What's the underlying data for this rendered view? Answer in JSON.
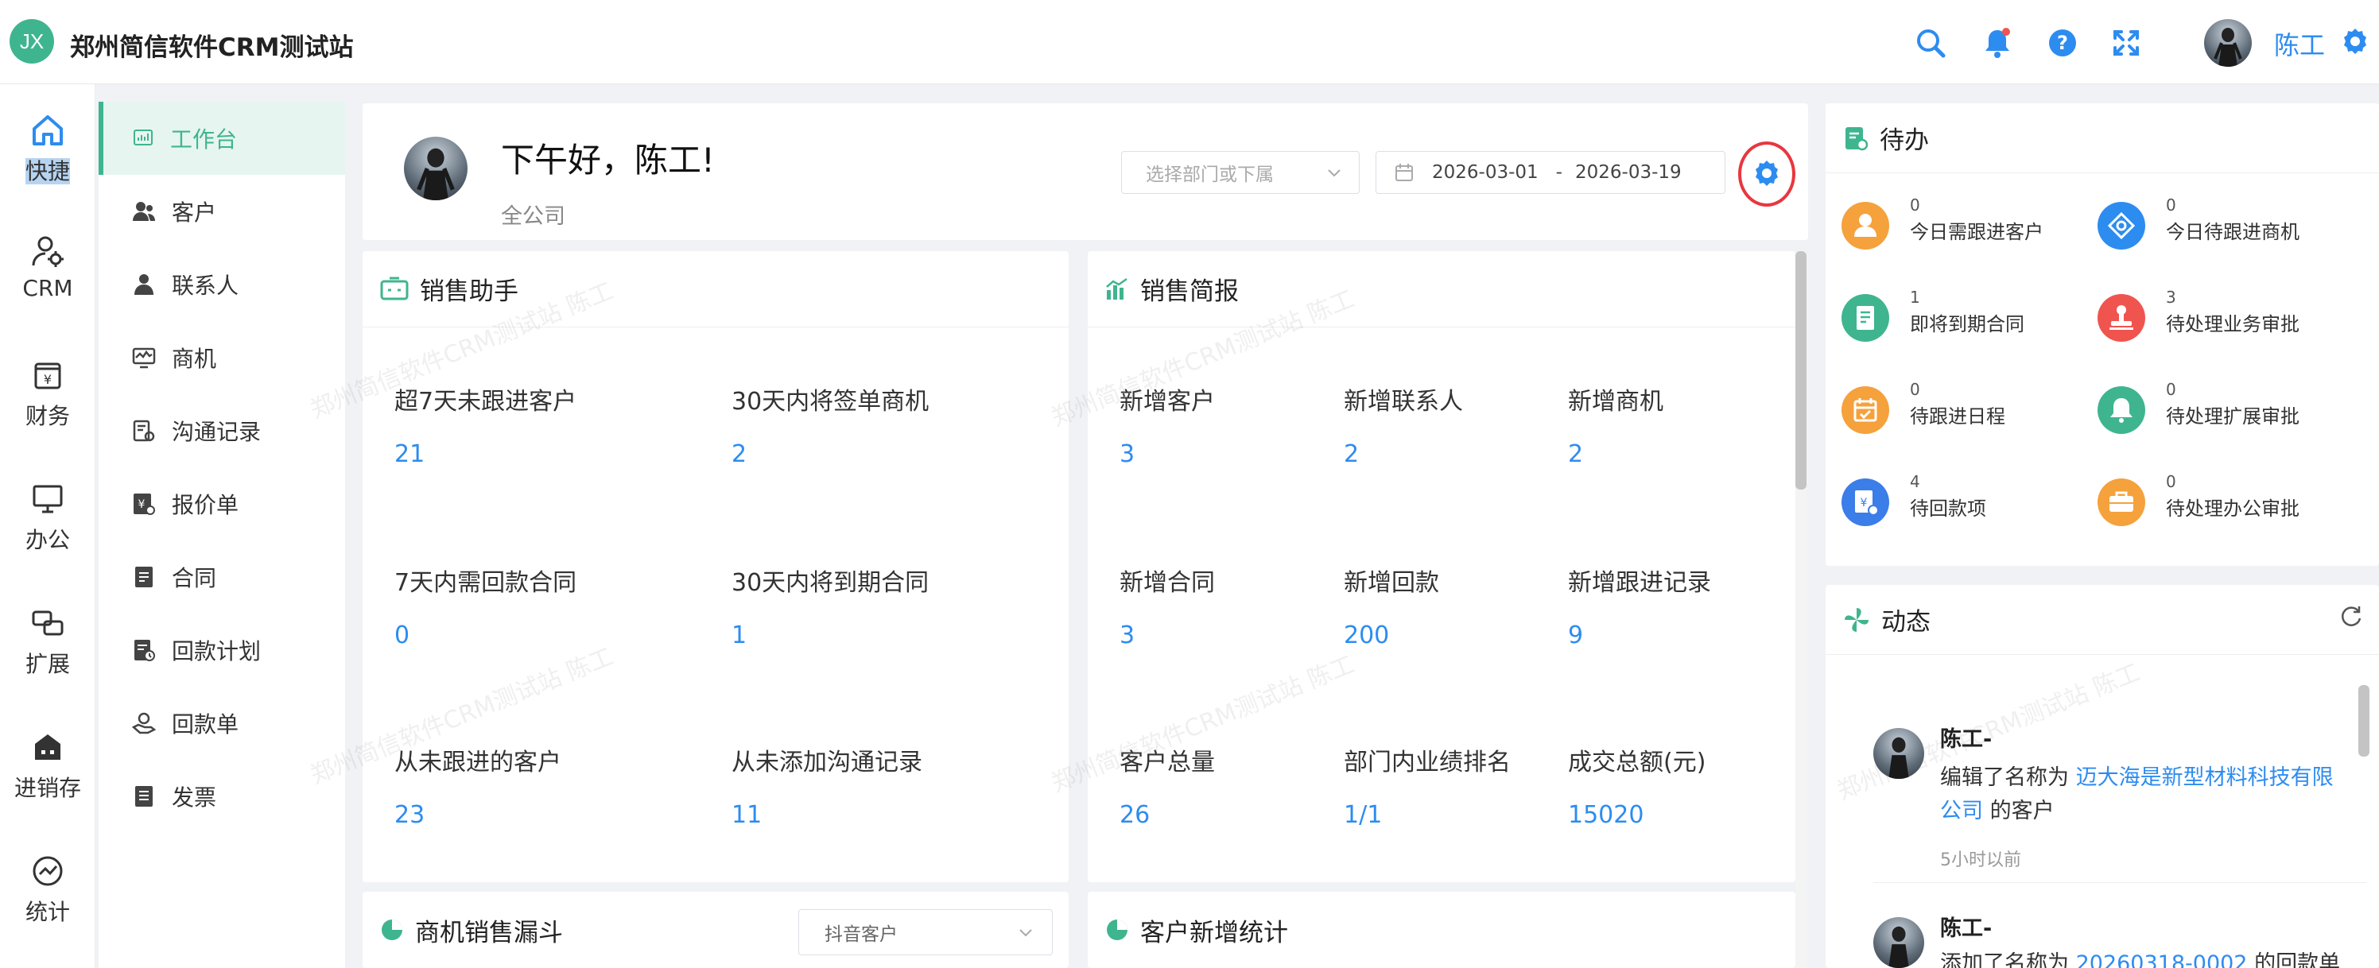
{
  "app": {
    "logo": "JX",
    "title": "郑州简信软件CRM测试站"
  },
  "user": {
    "name": "陈工"
  },
  "rail": [
    {
      "label": "快捷",
      "icon": "home-icon"
    },
    {
      "label": "CRM",
      "icon": "crm-icon"
    },
    {
      "label": "财务",
      "icon": "finance-icon"
    },
    {
      "label": "办公",
      "icon": "office-icon"
    },
    {
      "label": "扩展",
      "icon": "extend-icon"
    },
    {
      "label": "进销存",
      "icon": "inventory-icon"
    },
    {
      "label": "统计",
      "icon": "stats-icon"
    }
  ],
  "menu": [
    {
      "label": "工作台"
    },
    {
      "label": "客户"
    },
    {
      "label": "联系人"
    },
    {
      "label": "商机"
    },
    {
      "label": "沟通记录"
    },
    {
      "label": "报价单"
    },
    {
      "label": "合同"
    },
    {
      "label": "回款计划"
    },
    {
      "label": "回款单"
    },
    {
      "label": "发票"
    }
  ],
  "greeting": {
    "title": "下午好，陈工!",
    "scope": "全公司",
    "dept_placeholder": "选择部门或下属",
    "date_start": "2026-03-01",
    "date_sep": "-",
    "date_end": "2026-03-19"
  },
  "assistant": {
    "title": "销售助手",
    "items": [
      {
        "label": "超7天未跟进客户",
        "value": "21"
      },
      {
        "label": "30天内将签单商机",
        "value": "2"
      },
      {
        "label": "7天内需回款合同",
        "value": "0"
      },
      {
        "label": "30天内将到期合同",
        "value": "1"
      },
      {
        "label": "从未跟进的客户",
        "value": "23"
      },
      {
        "label": "从未添加沟通记录",
        "value": "11"
      }
    ]
  },
  "brief": {
    "title": "销售简报",
    "items": [
      {
        "label": "新增客户",
        "value": "3"
      },
      {
        "label": "新增联系人",
        "value": "2"
      },
      {
        "label": "新增商机",
        "value": "2"
      },
      {
        "label": "新增合同",
        "value": "3"
      },
      {
        "label": "新增回款",
        "value": "200"
      },
      {
        "label": "新增跟进记录",
        "value": "9"
      },
      {
        "label": "客户总量",
        "value": "26"
      },
      {
        "label": "部门内业绩排名",
        "value": "1/1"
      },
      {
        "label": "成交总额(元)",
        "value": "15020"
      }
    ]
  },
  "funnel": {
    "title": "商机销售漏斗",
    "select": "抖音客户"
  },
  "growth": {
    "title": "客户新增统计"
  },
  "watermark": "郑州简信软件CRM测试站 陈工",
  "todo": {
    "title": "待办",
    "items": [
      {
        "count": "0",
        "label": "今日需跟进客户",
        "color": "#f5a13c"
      },
      {
        "count": "0",
        "label": "今日待跟进商机",
        "color": "#2d8cf0"
      },
      {
        "count": "1",
        "label": "即将到期合同",
        "color": "#3fb58f"
      },
      {
        "count": "3",
        "label": "待处理业务审批",
        "color": "#f0544f"
      },
      {
        "count": "0",
        "label": "待跟进日程",
        "color": "#f5a13c"
      },
      {
        "count": "0",
        "label": "待处理扩展审批",
        "color": "#3fb58f"
      },
      {
        "count": "4",
        "label": "待回款项",
        "color": "#3b7de9"
      },
      {
        "count": "0",
        "label": "待处理办公审批",
        "color": "#f5a13c"
      }
    ]
  },
  "activity": {
    "title": "动态",
    "entries": [
      {
        "user": "陈工-",
        "action": "编辑了名称为",
        "link": "迈大海是新型材料科技有限公司",
        "suffix": "的客户",
        "time": "5小时以前"
      },
      {
        "user": "陈工-",
        "action": "添加了名称为",
        "link": "20260318-0002",
        "suffix": "的回款单",
        "time": ""
      }
    ]
  },
  "colors": {
    "accent": "#3fb58f",
    "link": "#2d8cf0",
    "highlight_ring": "#e8373f"
  }
}
